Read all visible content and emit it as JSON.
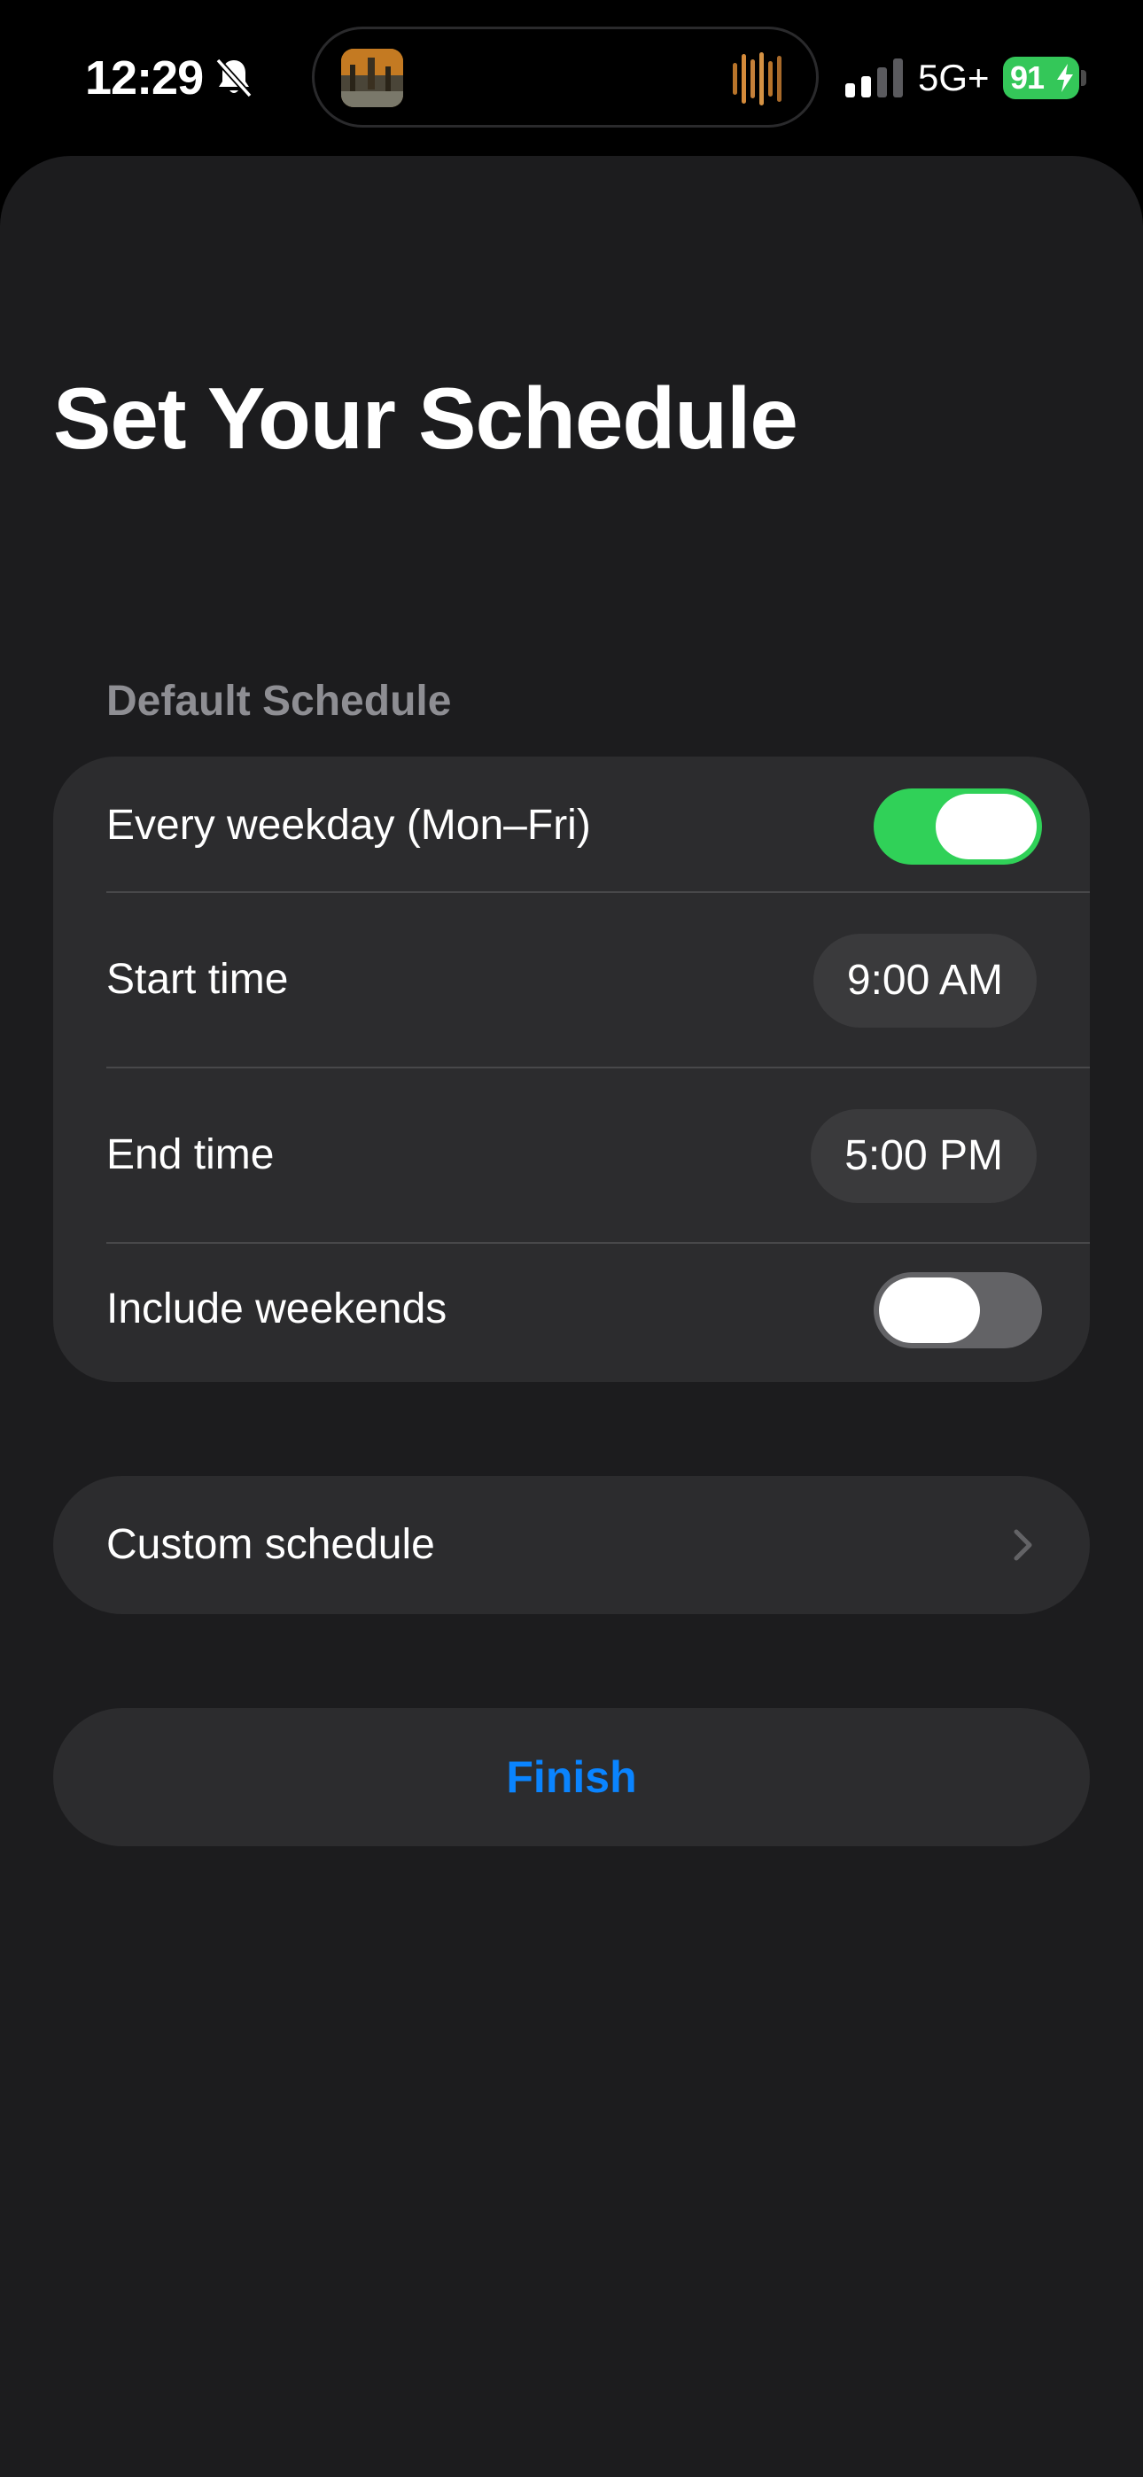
{
  "status_bar": {
    "time": "12:29",
    "network": "5G+",
    "battery_level": "91",
    "bell_icon": "bell-slash-icon",
    "signal_icon": "cellular-signal-icon",
    "signal_bars_active": 2,
    "signal_bars_total": 4,
    "dynamic_island": {
      "album_art_icon": "album-art-icon",
      "waveform_icon": "audio-waveform-icon"
    }
  },
  "page": {
    "title": "Set Your Schedule"
  },
  "default_schedule": {
    "header": "Default Schedule",
    "rows": [
      {
        "label": "Every weekday (Mon–Fri)",
        "type": "toggle",
        "value": true
      },
      {
        "label": "Start time",
        "type": "time",
        "value": "9:00 AM"
      },
      {
        "label": "End time",
        "type": "time",
        "value": "5:00 PM"
      },
      {
        "label": "Include weekends",
        "type": "toggle",
        "value": false
      }
    ]
  },
  "custom_schedule": {
    "label": "Custom schedule",
    "icon": "chevron-right-icon"
  },
  "actions": {
    "finish_label": "Finish"
  },
  "colors": {
    "accent": "#0a84ff",
    "toggle_on": "#30d158",
    "toggle_off": "#636366",
    "battery": "#34c759",
    "background": "#1c1c1e",
    "card": "#2c2c2e",
    "secondary_text": "#8e8e93"
  }
}
